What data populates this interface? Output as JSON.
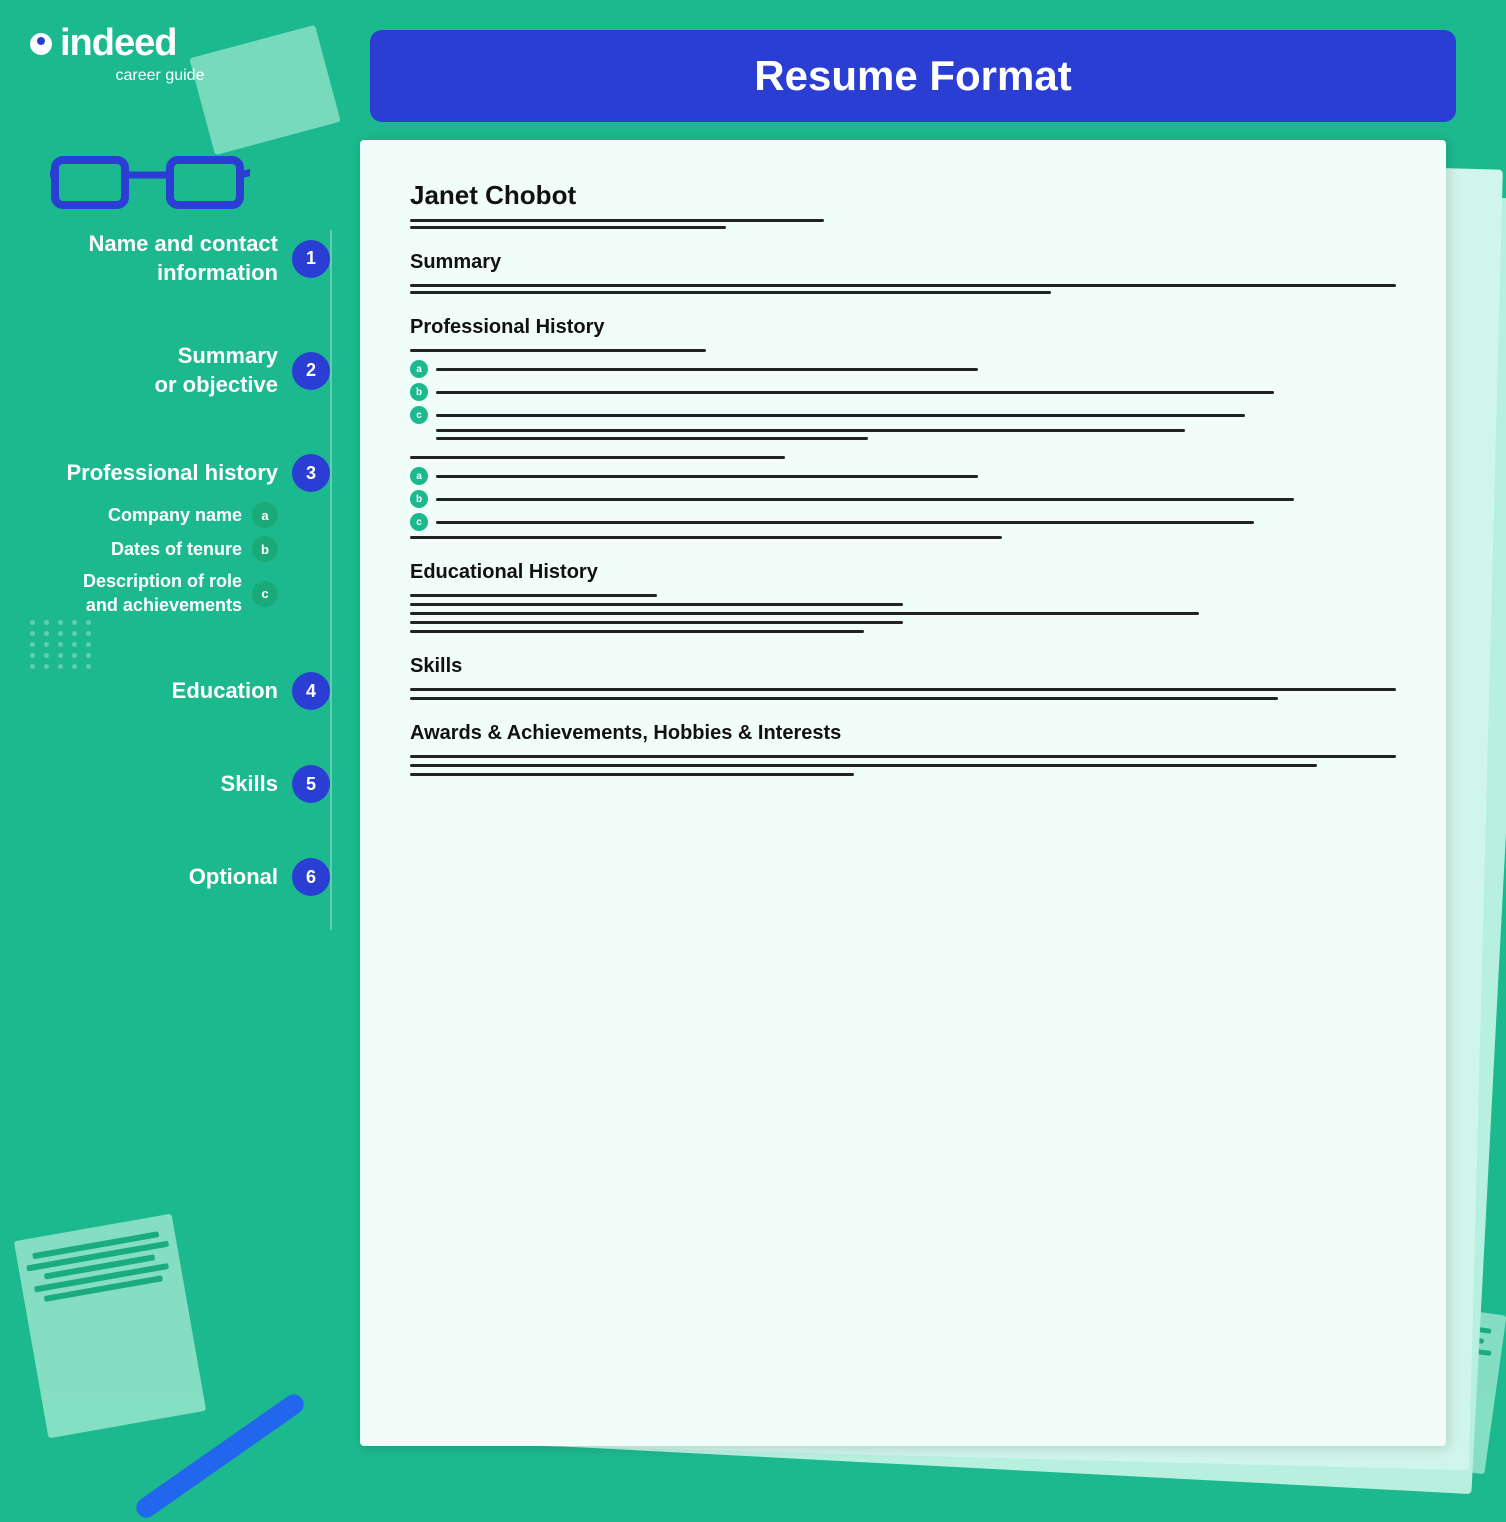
{
  "title": "Resume Format",
  "logo": {
    "brand": "indeed",
    "sub": "career guide"
  },
  "left_labels": [
    {
      "id": "label-1",
      "text": "Name and contact\ninformation",
      "number": "1"
    },
    {
      "id": "label-2",
      "text": "Summary\nor objective",
      "number": "2"
    },
    {
      "id": "label-3-header",
      "text": "Professional history",
      "number": "3",
      "sub_items": [
        {
          "text": "Company name",
          "alpha": "a"
        },
        {
          "text": "Dates of tenure",
          "alpha": "b"
        },
        {
          "text": "Description of role\nand achievements",
          "alpha": "c"
        }
      ]
    },
    {
      "id": "label-4",
      "text": "Education",
      "number": "4"
    },
    {
      "id": "label-5",
      "text": "Skills",
      "number": "5"
    },
    {
      "id": "label-6",
      "text": "Optional",
      "number": "6"
    }
  ],
  "resume": {
    "name": "Janet Chobot",
    "sections": [
      {
        "title": "Summary"
      },
      {
        "title": "Professional History"
      },
      {
        "title": "Educational History"
      },
      {
        "title": "Skills"
      },
      {
        "title": "Awards & Achievements, Hobbies & Interests"
      }
    ]
  }
}
